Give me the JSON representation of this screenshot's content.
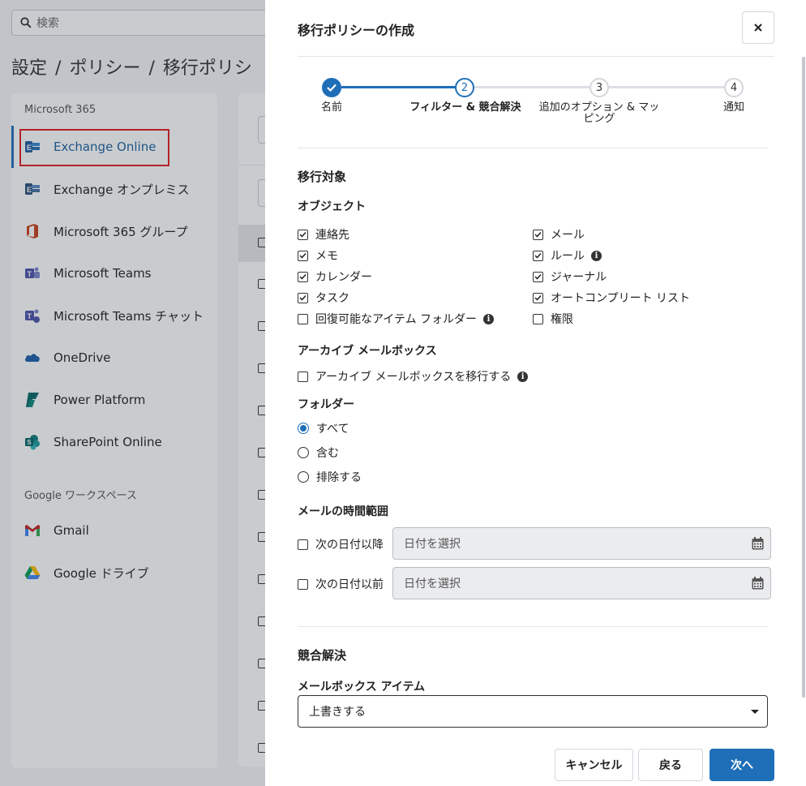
{
  "background": {
    "search_placeholder": "検索",
    "breadcrumb": [
      "設定",
      "ポリシー",
      "移行ポリシ"
    ],
    "sidebar": {
      "group1_title": "Microsoft 365",
      "group1_items": [
        {
          "label": "Exchange Online",
          "icon": "exchange-icon",
          "active": true
        },
        {
          "label": "Exchange オンプレミス",
          "icon": "exchange-icon"
        },
        {
          "label": "Microsoft 365 グループ",
          "icon": "office-icon"
        },
        {
          "label": "Microsoft Teams",
          "icon": "teams-icon"
        },
        {
          "label": "Microsoft Teams チャット",
          "icon": "teams-chat-icon"
        },
        {
          "label": "OneDrive",
          "icon": "onedrive-icon"
        },
        {
          "label": "Power Platform",
          "icon": "power-platform-icon"
        },
        {
          "label": "SharePoint Online",
          "icon": "sharepoint-icon"
        }
      ],
      "group2_title": "Google ワークスペース",
      "group2_items": [
        {
          "label": "Gmail",
          "icon": "gmail-icon"
        },
        {
          "label": "Google ドライブ",
          "icon": "google-drive-icon"
        }
      ]
    }
  },
  "modal": {
    "title": "移行ポリシーの作成",
    "steps": [
      {
        "number": "1",
        "label": "名前",
        "state": "done"
      },
      {
        "number": "2",
        "label": "フィルター & 競合解決",
        "state": "current"
      },
      {
        "number": "3",
        "label_line1": "追加のオプション & マッ",
        "label_line2": "ピング",
        "state": "todo"
      },
      {
        "number": "4",
        "label": "通知",
        "state": "todo"
      }
    ],
    "section_target": "移行対象",
    "objects_heading": "オブジェクト",
    "objects_left": [
      {
        "label": "連絡先",
        "checked": true
      },
      {
        "label": "メモ",
        "checked": true
      },
      {
        "label": "カレンダー",
        "checked": true
      },
      {
        "label": "タスク",
        "checked": true
      },
      {
        "label": "回復可能なアイテム フォルダー",
        "checked": false,
        "info": true
      }
    ],
    "objects_right": [
      {
        "label": "メール",
        "checked": true
      },
      {
        "label": "ルール",
        "checked": true,
        "info": true
      },
      {
        "label": "ジャーナル",
        "checked": true
      },
      {
        "label": "オートコンプリート リスト",
        "checked": true
      },
      {
        "label": "権限",
        "checked": false
      }
    ],
    "archive_heading": "アーカイブ メールボックス",
    "archive_option": {
      "label": "アーカイブ メールボックスを移行する",
      "checked": false
    },
    "folder_heading": "フォルダー",
    "folder_options": [
      {
        "label": "すべて",
        "selected": true
      },
      {
        "label": "含む",
        "selected": false
      },
      {
        "label": "排除する",
        "selected": false
      }
    ],
    "mail_range_heading": "メールの時間範囲",
    "date_after": {
      "label": "次の日付以降",
      "placeholder": "日付を選択",
      "checked": false
    },
    "date_before": {
      "label": "次の日付以前",
      "placeholder": "日付を選択",
      "checked": false
    },
    "conflict_heading": "競合解決",
    "mailbox_items_heading": "メールボックス アイテム",
    "mailbox_items_value": "上書きする",
    "buttons": {
      "cancel": "キャンセル",
      "back": "戻る",
      "next": "次へ"
    },
    "colors": {
      "accent": "#1f6fb8",
      "highlight_border": "#e02020"
    }
  }
}
